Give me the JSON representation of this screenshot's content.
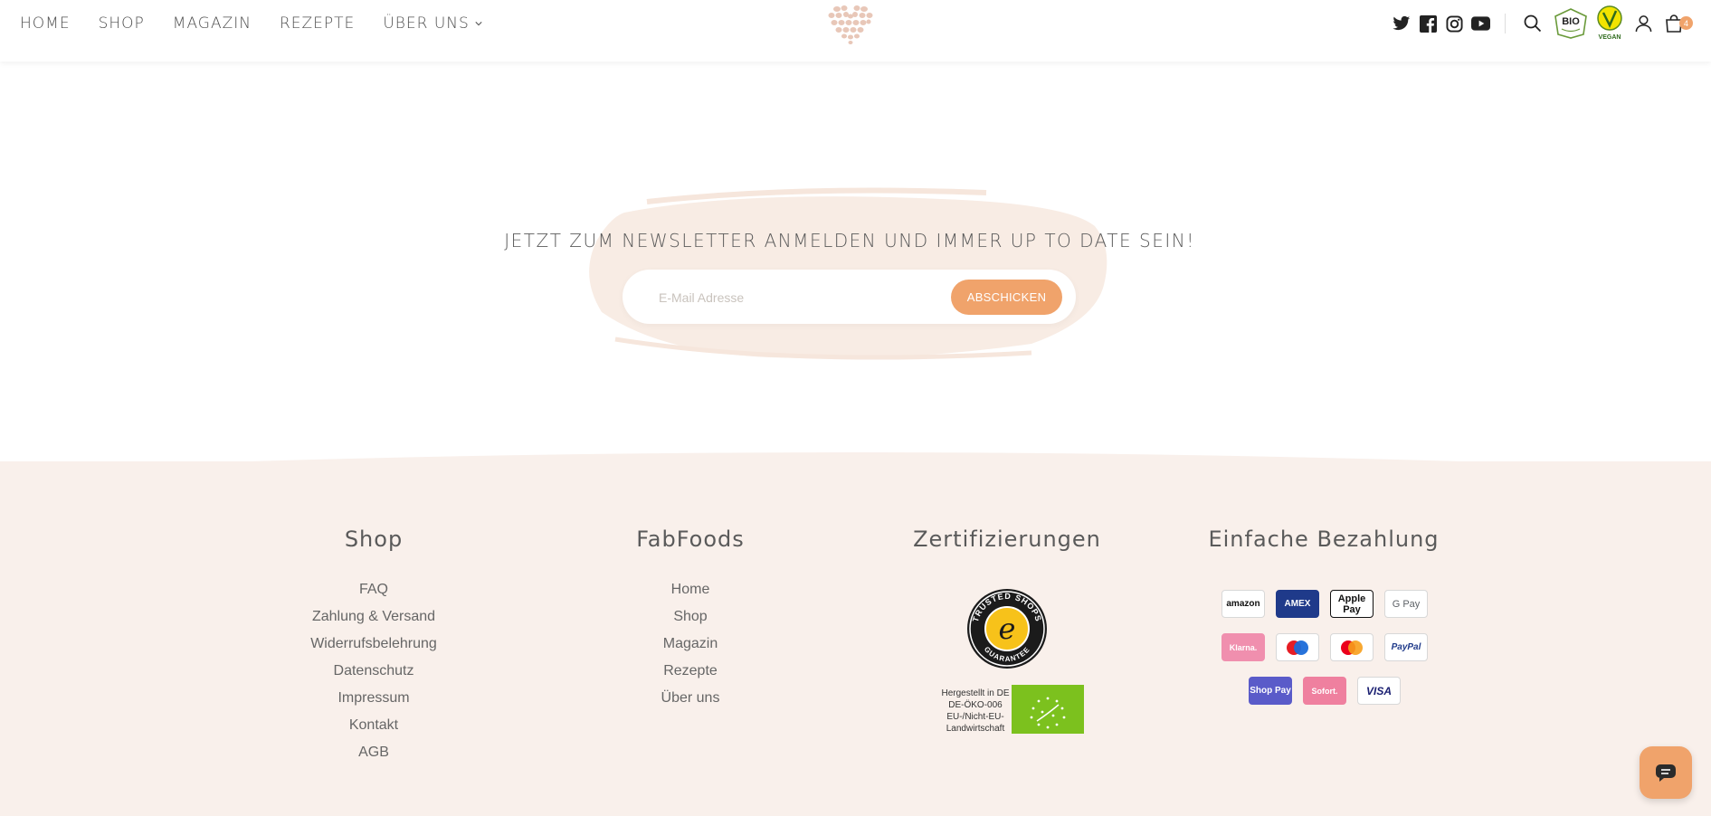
{
  "nav": {
    "items": [
      {
        "label": "HOME"
      },
      {
        "label": "SHOP"
      },
      {
        "label": "MAGAZIN"
      },
      {
        "label": "REZEPTE"
      },
      {
        "label": "ÜBER UNS",
        "has_dropdown": true
      }
    ]
  },
  "header": {
    "icons": [
      "twitter-icon",
      "facebook-icon",
      "instagram-icon",
      "youtube-icon",
      "search-icon",
      "bio-badge",
      "vegan-badge",
      "account-icon",
      "cart-icon"
    ],
    "cart_count": "4",
    "bio_text": "BIO",
    "vegan_text": "VEGAN"
  },
  "newsletter": {
    "title": "JETZT ZUM NEWSLETTER ANMELDEN UND IMMER UP TO DATE SEIN!",
    "placeholder": "E-Mail Adresse",
    "button": "ABSCHICKEN"
  },
  "footer": {
    "shop": {
      "title": "Shop",
      "links": [
        "FAQ",
        "Zahlung & Versand",
        "Widerrufsbelehrung",
        "Datenschutz",
        "Impressum",
        "Kontakt",
        "AGB"
      ]
    },
    "fabfoods": {
      "title": "FabFoods",
      "links": [
        "Home",
        "Shop",
        "Magazin",
        "Rezepte",
        "Über uns"
      ]
    },
    "certs": {
      "title": "Zertifizierungen",
      "trusted_text": "TRUSTED SHOPS",
      "guarantee_text": "GUARANTEE",
      "eco_lines": [
        "Hergestellt in DE",
        "DE-ÖKO-006",
        "EU-/Nicht-EU-",
        "Landwirtschaft"
      ]
    },
    "payment": {
      "title": "Einfache Bezahlung",
      "rows": [
        [
          "amazon",
          "AMEX",
          "Apple Pay",
          "G Pay"
        ],
        [
          "Klarna.",
          "maestro",
          "mastercard",
          "PayPal"
        ],
        [
          "Shop Pay",
          "Sofort.",
          "VISA"
        ]
      ]
    }
  },
  "colors": {
    "accent": "#f0a36b",
    "footer_bg": "#f9f0eb",
    "text": "#5a5a5a"
  }
}
